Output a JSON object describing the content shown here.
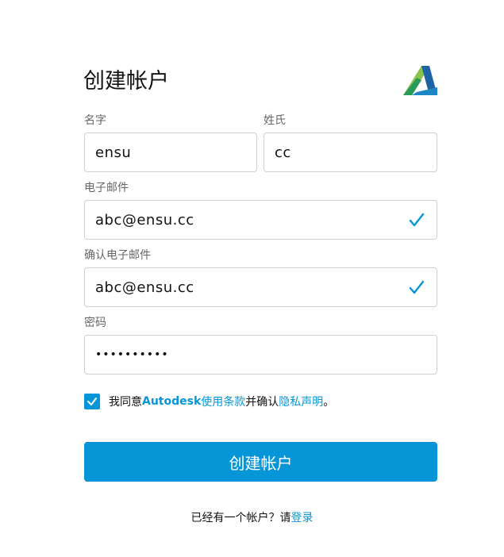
{
  "title": "创建帐户",
  "form": {
    "first_name": {
      "label": "名字",
      "value": "ensu"
    },
    "last_name": {
      "label": "姓氏",
      "value": "cc"
    },
    "email": {
      "label": "电子邮件",
      "value": "abc@ensu.cc",
      "validated": true
    },
    "confirm_email": {
      "label": "确认电子邮件",
      "value": "abc@ensu.cc",
      "validated": true
    },
    "password": {
      "label": "密码",
      "value": "••••••••••"
    }
  },
  "consent": {
    "checked": true,
    "prefix": "我同意 ",
    "brand": "Autodesk",
    "terms_link": " 使用条款",
    "middle": "并确认",
    "privacy_link": "隐私声明",
    "suffix": "。"
  },
  "submit_label": "创建帐户",
  "signin": {
    "prompt": "已经有一个帐户？请",
    "link": "登录"
  },
  "colors": {
    "accent": "#0696d7",
    "border": "#cfcfcf",
    "label": "#666666"
  },
  "icons": [
    "autodesk-logo-icon",
    "checkmark-icon",
    "checkbox-checked-icon"
  ]
}
